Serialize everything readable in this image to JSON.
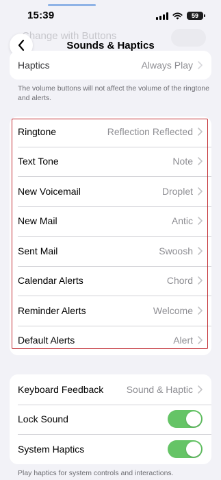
{
  "status": {
    "time": "15:39",
    "battery": "59"
  },
  "volume_level": 1.0,
  "colors": {
    "toggle_on": "#65c466",
    "highlight": "#c0282e",
    "chevron": "#c4c4c7"
  },
  "nav": {
    "title": "Sounds & Haptics",
    "back_icon": "chevron-left-icon"
  },
  "ghost": {
    "label": "Change with Buttons"
  },
  "haptics_row": {
    "label": "Haptics",
    "value": "Always Play"
  },
  "volume_note": "The volume buttons will not affect the volume of the ringtone and alerts.",
  "sounds": [
    {
      "label": "Ringtone",
      "value": "Reflection Reflected"
    },
    {
      "label": "Text Tone",
      "value": "Note"
    },
    {
      "label": "New Voicemail",
      "value": "Droplet"
    },
    {
      "label": "New Mail",
      "value": "Antic"
    },
    {
      "label": "Sent Mail",
      "value": "Swoosh"
    },
    {
      "label": "Calendar Alerts",
      "value": "Chord"
    },
    {
      "label": "Reminder Alerts",
      "value": "Welcome"
    },
    {
      "label": "Default Alerts",
      "value": "Alert"
    }
  ],
  "feedback": {
    "keyboard": {
      "label": "Keyboard Feedback",
      "value": "Sound & Haptic"
    },
    "lock_sound": {
      "label": "Lock Sound",
      "on": true
    },
    "system_haptics": {
      "label": "System Haptics",
      "on": true
    }
  },
  "haptics_note": "Play haptics for system controls and interactions."
}
